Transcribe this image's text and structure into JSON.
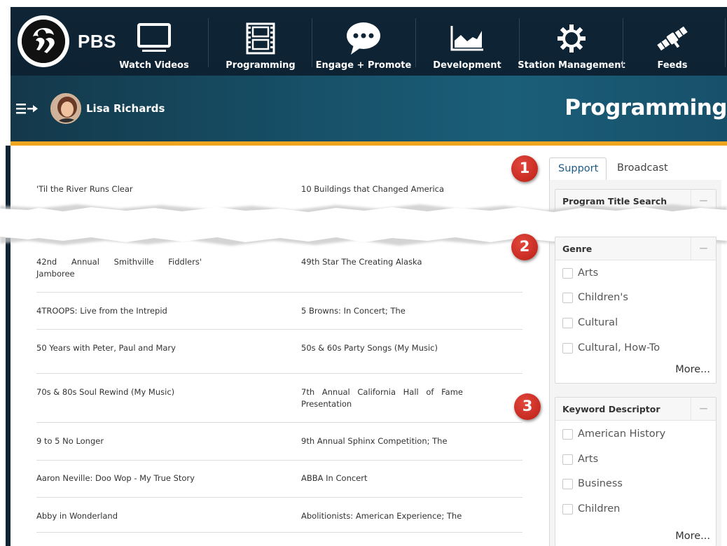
{
  "brand": {
    "name": "PBS"
  },
  "nav": [
    {
      "label": "Watch Videos",
      "icon": "monitor-icon"
    },
    {
      "label": "Programming",
      "icon": "film-icon"
    },
    {
      "label": "Engage + Promote",
      "icon": "chat-bubble-icon"
    },
    {
      "label": "Development",
      "icon": "area-chart-icon"
    },
    {
      "label": "Station Management",
      "icon": "gear-icon"
    },
    {
      "label": "Feeds",
      "icon": "satellite-icon"
    }
  ],
  "user": {
    "name": "Lisa Richards"
  },
  "page": {
    "title": "Programming"
  },
  "programs": {
    "top_row": {
      "left": "'Til the River Runs Clear",
      "right": "10 Buildings that Changed America"
    },
    "rows": [
      {
        "left": "42nd Annual Smithville Fiddlers' Jamboree",
        "right": "49th Star The Creating Alaska"
      },
      {
        "left": "4TROOPS: Live from the Intrepid",
        "right": "5 Browns: In Concert; The"
      },
      {
        "left": "50 Years with Peter, Paul and Mary",
        "right": "50s & 60s Party Songs (My Music)"
      },
      {
        "left": "70s & 80s Soul Rewind (My Music)",
        "right": "7th Annual California Hall of Fame Presentation"
      },
      {
        "left": "9 to 5 No Longer",
        "right": "9th Annual Sphinx Competition; The"
      },
      {
        "left": "Aaron Neville: Doo Wop - My True Story",
        "right": "ABBA In Concert"
      },
      {
        "left": "Abby in Wonderland",
        "right": "Abolitionists: American Experience; The"
      }
    ]
  },
  "tabs": {
    "support": "Support",
    "broadcast": "Broadcast"
  },
  "panels": {
    "search": {
      "title": "Program Title Search"
    },
    "genre": {
      "title": "Genre",
      "options": [
        "Arts",
        "Children's",
        "Cultural",
        "Cultural, How-To"
      ],
      "more": "More..."
    },
    "keyword": {
      "title": "Keyword Descriptor",
      "options": [
        "American History",
        "Arts",
        "Business",
        "Children"
      ],
      "more": "More..."
    }
  },
  "badges": [
    "1",
    "2",
    "3"
  ],
  "colors": {
    "nav_bg": "#0f2535",
    "accent_orange": "#f0a51e",
    "badge_red": "#c72a21",
    "active_tab_text": "#1e5b84"
  }
}
